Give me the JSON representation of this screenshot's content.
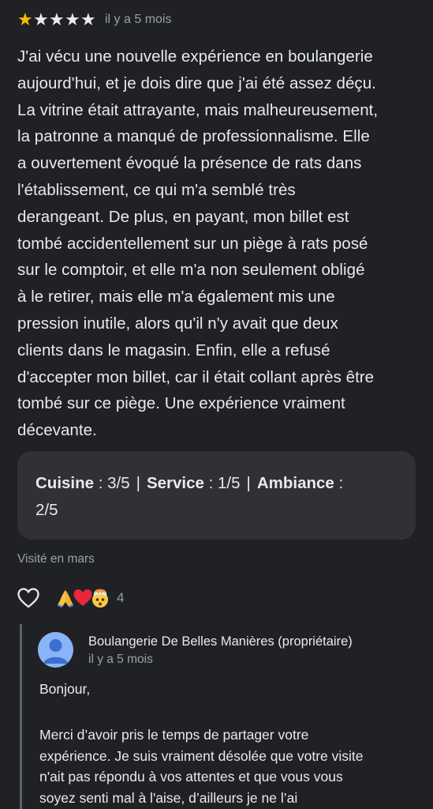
{
  "review": {
    "rating": 1,
    "max_rating": 5,
    "time_ago": "il y a 5 mois",
    "text": "J'ai vécu une nouvelle expérience en boulangerie\naujourd'hui, et je dois dire que j'ai été assez déçu.\nLa vitrine était attrayante, mais malheureusement,\nla patronne a manqué de professionnalisme. Elle\na ouvertement évoqué la présence de rats dans\nl'établissement, ce qui m'a semblé très\nderangeant. De plus, en payant, mon billet est\ntombé accidentellement sur un piège à rats posé\nsur le comptoir, et elle m'a non seulement obligé\nà le retirer, mais elle m'a également mis une\npression inutile, alors qu'il n'y avait que deux\nclients dans le magasin. Enfin, elle a refusé\nd'accepter mon billet, car il était collant après être\ntombé sur ce piège. Une expérience vraiment\ndécevante.",
    "subratings": {
      "cuisine_label": "Cuisine",
      "cuisine_value": " : 3/5",
      "service_label": "Service",
      "service_value": " : 1/5",
      "ambiance_label": "Ambiance",
      "ambiance_value": " :",
      "ambiance_value_line2": "2/5"
    },
    "visited": "Visité en mars",
    "reactions": {
      "emojis": [
        "folded-hands",
        "red-heart",
        "face-with-exploding-head"
      ],
      "count": "4"
    }
  },
  "owner_reply": {
    "name": "Boulangerie De Belles Manières (propriétaire)",
    "time_ago": "il y a 5 mois",
    "greeting": "Bonjour,",
    "body": "Merci d’avoir pris le temps de partager votre\nexpérience. Je suis vraiment désolée que votre visite\nn'ait pas répondu à vos attentes et que vous vous\nsoyez senti mal à l'aise, d’ailleurs je ne l’ai"
  },
  "colors": {
    "background": "#202124",
    "star_filled": "#fbbc04",
    "card_background": "#303134",
    "avatar": "#8ab4f8",
    "muted_text": "#9aa0a6"
  }
}
